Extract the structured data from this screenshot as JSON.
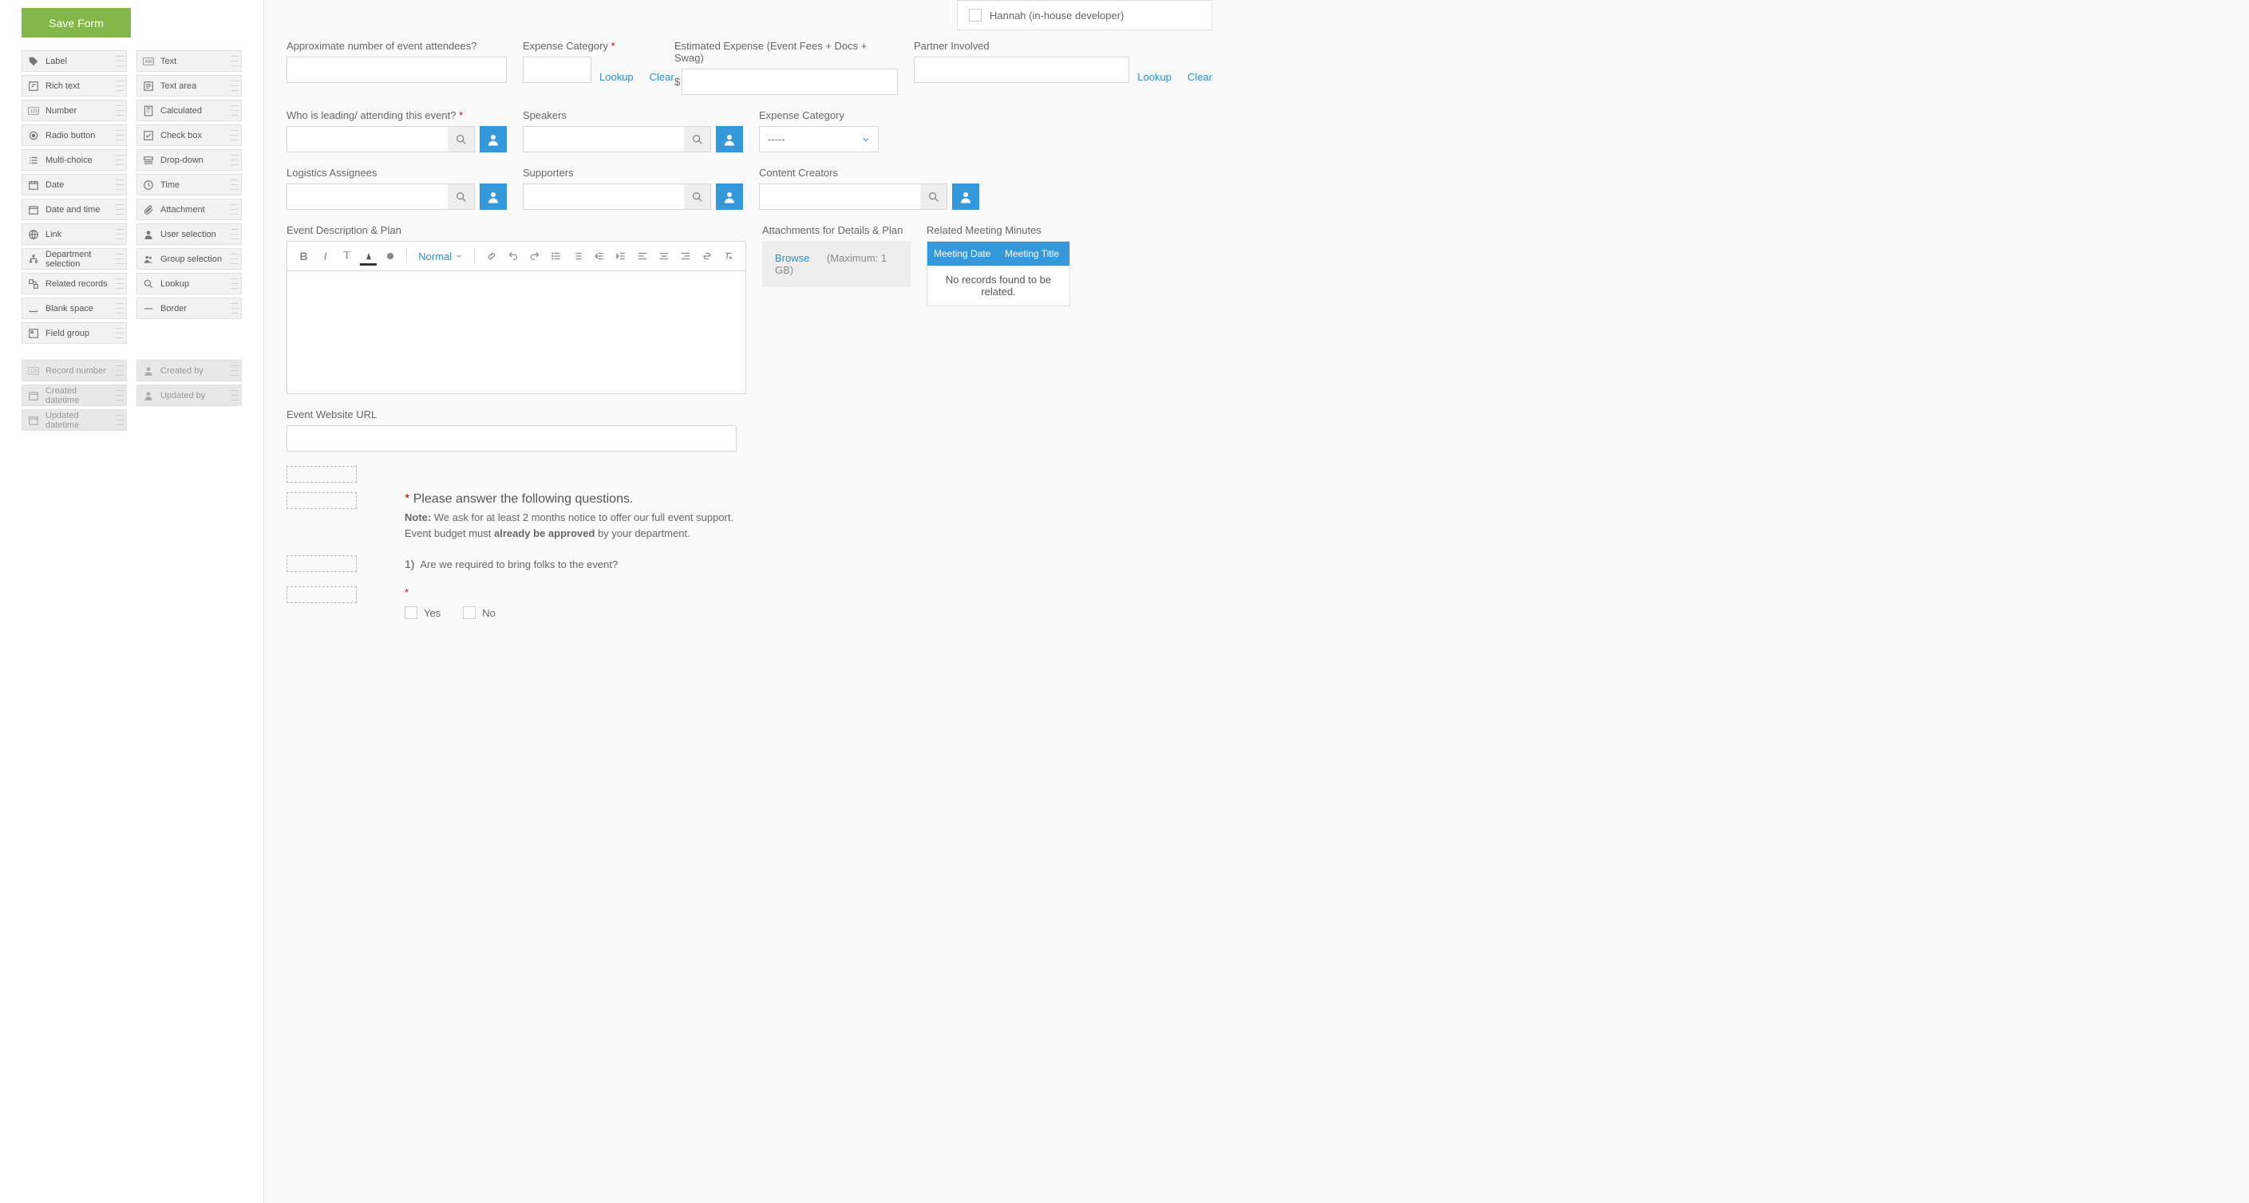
{
  "save_button": "Save Form",
  "palette": {
    "col1": [
      "Label",
      "Rich text",
      "Number",
      "Radio button",
      "Multi-choice",
      "Date",
      "Date and time",
      "Link",
      "Department selection",
      "Related records",
      "Blank space",
      "Field group"
    ],
    "col2": [
      "Text",
      "Text area",
      "Calculated",
      "Check box",
      "Drop-down",
      "Time",
      "Attachment",
      "User selection",
      "Group selection",
      "Lookup",
      "Border"
    ]
  },
  "sys_palette": {
    "col1": [
      "Record number",
      "Created datetime",
      "Updated datetime"
    ],
    "col2": [
      "Created by",
      "Updated by"
    ]
  },
  "checkbox_label": "Hannah (in-house developer)",
  "labels": {
    "attendees": "Approximate number of event attendees?",
    "exp_cat": "Expense Category",
    "est_exp": "Estimated Expense (Event Fees + Docs + Swag)",
    "partner": "Partner Involved",
    "who": "Who is leading/ attending this event?",
    "speakers": "Speakers",
    "exp_cat2": "Expense Category",
    "logistics": "Logistics Assignees",
    "supporters": "Supporters",
    "creators": "Content Creators",
    "desc": "Event Description & Plan",
    "attach": "Attachments for Details & Plan",
    "related": "Related Meeting Minutes",
    "url": "Event Website URL"
  },
  "links": {
    "lookup": "Lookup",
    "clear": "Clear",
    "browse": "Browse"
  },
  "currency": "$",
  "select_placeholder": "-----",
  "rte_dd": "Normal",
  "attach_max": "(Maximum: 1 GB)",
  "related_headers": [
    "Meeting Date",
    "Meeting Title"
  ],
  "related_empty": "No records found to be related.",
  "questions": {
    "heading": "Please answer the following questions.",
    "note_label": "Note:",
    "note1": " We ask for at least 2 months notice to offer our full event support.",
    "note2a": "Event budget must ",
    "note2b": "already be approved",
    "note2c": " by your department.",
    "q1num": "1)",
    "q1": " Are we required to bring folks to the event?",
    "yes": "Yes",
    "no": "No"
  }
}
